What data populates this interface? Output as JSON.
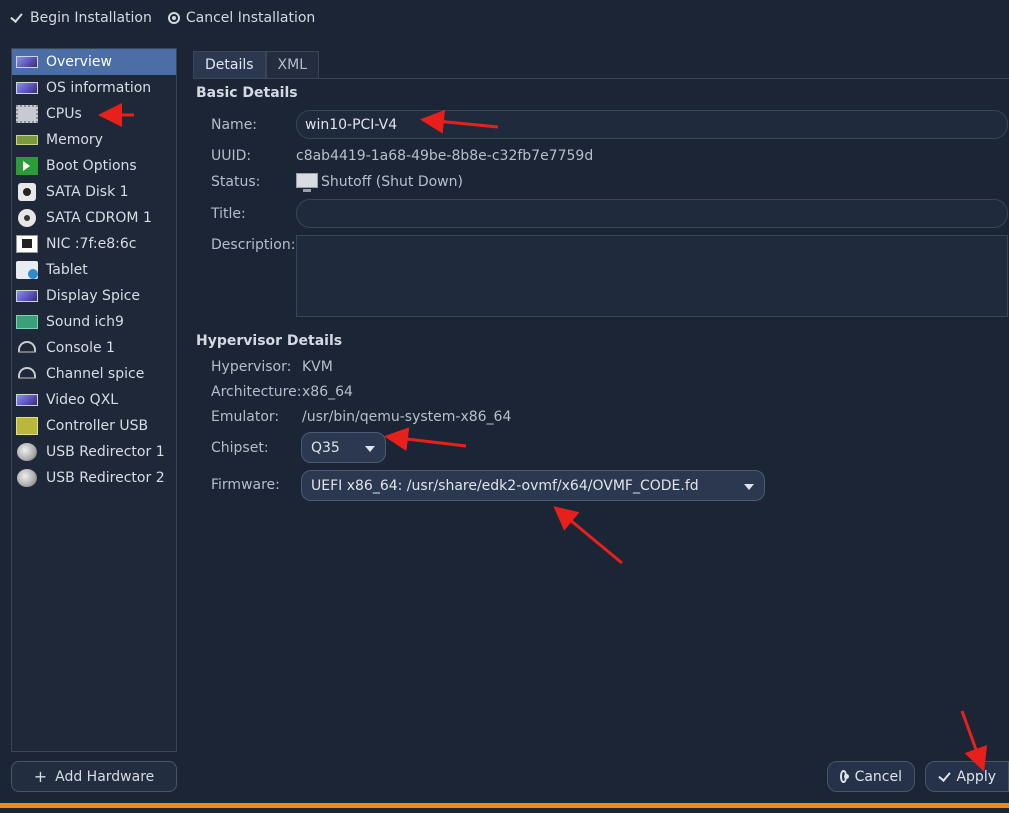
{
  "toolbar": {
    "begin_label": "Begin Installation",
    "cancel_label": "Cancel Installation"
  },
  "sidebar": {
    "items": [
      {
        "label": "Overview",
        "icon": "monitor-icon"
      },
      {
        "label": "OS information",
        "icon": "monitor-icon"
      },
      {
        "label": "CPUs",
        "icon": "cpu-icon"
      },
      {
        "label": "Memory",
        "icon": "memory-icon"
      },
      {
        "label": "Boot Options",
        "icon": "boot-icon"
      },
      {
        "label": "SATA Disk 1",
        "icon": "disk-icon"
      },
      {
        "label": "SATA CDROM 1",
        "icon": "cdrom-icon"
      },
      {
        "label": "NIC :7f:e8:6c",
        "icon": "nic-icon"
      },
      {
        "label": "Tablet",
        "icon": "tablet-icon"
      },
      {
        "label": "Display Spice",
        "icon": "display-icon"
      },
      {
        "label": "Sound ich9",
        "icon": "sound-icon"
      },
      {
        "label": "Console 1",
        "icon": "console-icon"
      },
      {
        "label": "Channel spice",
        "icon": "channel-icon"
      },
      {
        "label": "Video QXL",
        "icon": "video-icon"
      },
      {
        "label": "Controller USB",
        "icon": "usb-controller-icon"
      },
      {
        "label": "USB Redirector 1",
        "icon": "usb-redirector-icon"
      },
      {
        "label": "USB Redirector 2",
        "icon": "usb-redirector-icon"
      }
    ],
    "add_hardware_label": "Add Hardware"
  },
  "tabs": {
    "details": "Details",
    "xml": "XML"
  },
  "basic": {
    "title": "Basic Details",
    "name_label": "Name:",
    "name_value": "win10-PCI-V4",
    "uuid_label": "UUID:",
    "uuid_value": "c8ab4419-1a68-49be-8b8e-c32fb7e7759d",
    "status_label": "Status:",
    "status_value": "Shutoff (Shut Down)",
    "title_label": "Title:",
    "title_value": "",
    "description_label": "Description:",
    "description_value": ""
  },
  "hypervisor": {
    "title": "Hypervisor Details",
    "hypervisor_label": "Hypervisor:",
    "hypervisor_value": "KVM",
    "arch_label": "Architecture:",
    "arch_value": "x86_64",
    "emulator_label": "Emulator:",
    "emulator_value": "/usr/bin/qemu-system-x86_64",
    "chipset_label": "Chipset:",
    "chipset_value": "Q35",
    "firmware_label": "Firmware:",
    "firmware_value": "UEFI x86_64: /usr/share/edk2-ovmf/x64/OVMF_CODE.fd"
  },
  "actions": {
    "cancel_label": "Cancel",
    "apply_label": "Apply"
  },
  "colors": {
    "background": "#1b2536",
    "selection": "#4b6ea6",
    "accent_bar": "#ef8a1e",
    "annotation_arrow": "#e8201c"
  }
}
